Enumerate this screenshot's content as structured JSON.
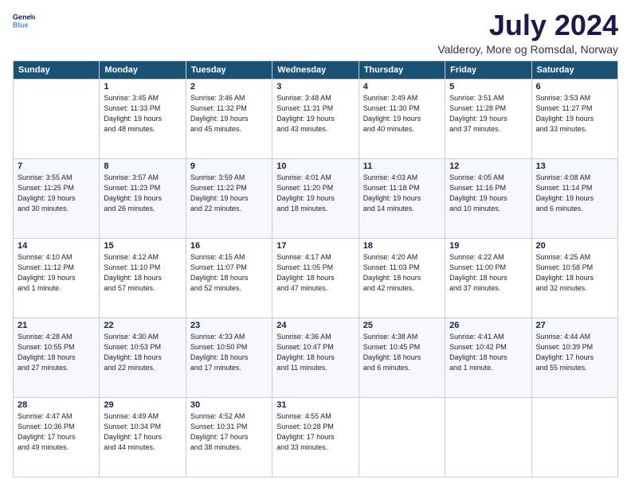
{
  "logo": {
    "line1": "General",
    "line2": "Blue"
  },
  "title": "July 2024",
  "subtitle": "Valderoy, More og Romsdal, Norway",
  "header_days": [
    "Sunday",
    "Monday",
    "Tuesday",
    "Wednesday",
    "Thursday",
    "Friday",
    "Saturday"
  ],
  "weeks": [
    [
      {
        "day": "",
        "info": ""
      },
      {
        "day": "1",
        "info": "Sunrise: 3:45 AM\nSunset: 11:33 PM\nDaylight: 19 hours\nand 48 minutes."
      },
      {
        "day": "2",
        "info": "Sunrise: 3:46 AM\nSunset: 11:32 PM\nDaylight: 19 hours\nand 45 minutes."
      },
      {
        "day": "3",
        "info": "Sunrise: 3:48 AM\nSunset: 11:31 PM\nDaylight: 19 hours\nand 43 minutes."
      },
      {
        "day": "4",
        "info": "Sunrise: 3:49 AM\nSunset: 11:30 PM\nDaylight: 19 hours\nand 40 minutes."
      },
      {
        "day": "5",
        "info": "Sunrise: 3:51 AM\nSunset: 11:28 PM\nDaylight: 19 hours\nand 37 minutes."
      },
      {
        "day": "6",
        "info": "Sunrise: 3:53 AM\nSunset: 11:27 PM\nDaylight: 19 hours\nand 33 minutes."
      }
    ],
    [
      {
        "day": "7",
        "info": "Sunrise: 3:55 AM\nSunset: 11:25 PM\nDaylight: 19 hours\nand 30 minutes."
      },
      {
        "day": "8",
        "info": "Sunrise: 3:57 AM\nSunset: 11:23 PM\nDaylight: 19 hours\nand 26 minutes."
      },
      {
        "day": "9",
        "info": "Sunrise: 3:59 AM\nSunset: 11:22 PM\nDaylight: 19 hours\nand 22 minutes."
      },
      {
        "day": "10",
        "info": "Sunrise: 4:01 AM\nSunset: 11:20 PM\nDaylight: 19 hours\nand 18 minutes."
      },
      {
        "day": "11",
        "info": "Sunrise: 4:03 AM\nSunset: 11:18 PM\nDaylight: 19 hours\nand 14 minutes."
      },
      {
        "day": "12",
        "info": "Sunrise: 4:05 AM\nSunset: 11:16 PM\nDaylight: 19 hours\nand 10 minutes."
      },
      {
        "day": "13",
        "info": "Sunrise: 4:08 AM\nSunset: 11:14 PM\nDaylight: 19 hours\nand 6 minutes."
      }
    ],
    [
      {
        "day": "14",
        "info": "Sunrise: 4:10 AM\nSunset: 11:12 PM\nDaylight: 19 hours\nand 1 minute."
      },
      {
        "day": "15",
        "info": "Sunrise: 4:12 AM\nSunset: 11:10 PM\nDaylight: 18 hours\nand 57 minutes."
      },
      {
        "day": "16",
        "info": "Sunrise: 4:15 AM\nSunset: 11:07 PM\nDaylight: 18 hours\nand 52 minutes."
      },
      {
        "day": "17",
        "info": "Sunrise: 4:17 AM\nSunset: 11:05 PM\nDaylight: 18 hours\nand 47 minutes."
      },
      {
        "day": "18",
        "info": "Sunrise: 4:20 AM\nSunset: 11:03 PM\nDaylight: 18 hours\nand 42 minutes."
      },
      {
        "day": "19",
        "info": "Sunrise: 4:22 AM\nSunset: 11:00 PM\nDaylight: 18 hours\nand 37 minutes."
      },
      {
        "day": "20",
        "info": "Sunrise: 4:25 AM\nSunset: 10:58 PM\nDaylight: 18 hours\nand 32 minutes."
      }
    ],
    [
      {
        "day": "21",
        "info": "Sunrise: 4:28 AM\nSunset: 10:55 PM\nDaylight: 18 hours\nand 27 minutes."
      },
      {
        "day": "22",
        "info": "Sunrise: 4:30 AM\nSunset: 10:53 PM\nDaylight: 18 hours\nand 22 minutes."
      },
      {
        "day": "23",
        "info": "Sunrise: 4:33 AM\nSunset: 10:50 PM\nDaylight: 18 hours\nand 17 minutes."
      },
      {
        "day": "24",
        "info": "Sunrise: 4:36 AM\nSunset: 10:47 PM\nDaylight: 18 hours\nand 11 minutes."
      },
      {
        "day": "25",
        "info": "Sunrise: 4:38 AM\nSunset: 10:45 PM\nDaylight: 18 hours\nand 6 minutes."
      },
      {
        "day": "26",
        "info": "Sunrise: 4:41 AM\nSunset: 10:42 PM\nDaylight: 18 hours\nand 1 minute."
      },
      {
        "day": "27",
        "info": "Sunrise: 4:44 AM\nSunset: 10:39 PM\nDaylight: 17 hours\nand 55 minutes."
      }
    ],
    [
      {
        "day": "28",
        "info": "Sunrise: 4:47 AM\nSunset: 10:36 PM\nDaylight: 17 hours\nand 49 minutes."
      },
      {
        "day": "29",
        "info": "Sunrise: 4:49 AM\nSunset: 10:34 PM\nDaylight: 17 hours\nand 44 minutes."
      },
      {
        "day": "30",
        "info": "Sunrise: 4:52 AM\nSunset: 10:31 PM\nDaylight: 17 hours\nand 38 minutes."
      },
      {
        "day": "31",
        "info": "Sunrise: 4:55 AM\nSunset: 10:28 PM\nDaylight: 17 hours\nand 33 minutes."
      },
      {
        "day": "",
        "info": ""
      },
      {
        "day": "",
        "info": ""
      },
      {
        "day": "",
        "info": ""
      }
    ]
  ]
}
